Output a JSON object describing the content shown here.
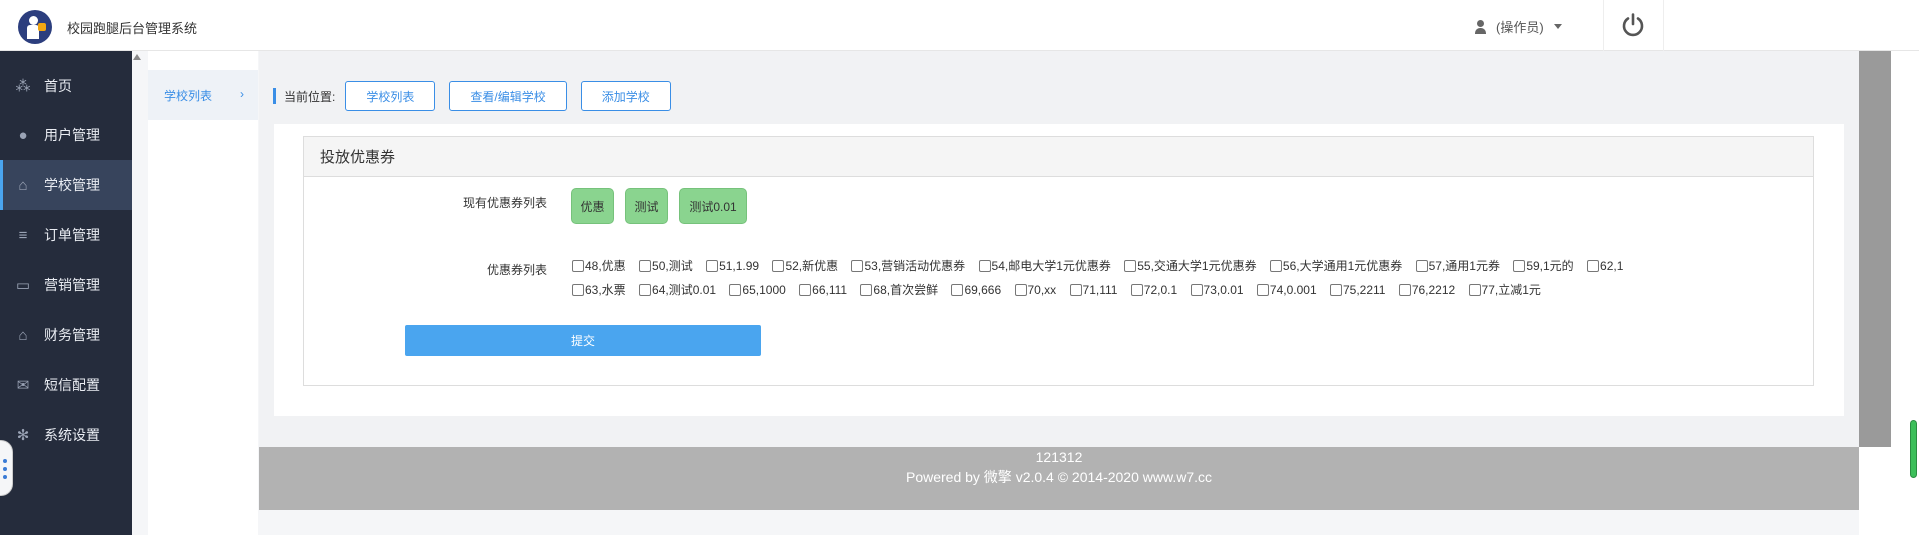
{
  "header": {
    "app_title": "校园跑腿后台管理系统",
    "user_label": "(操作员)"
  },
  "sidebar": {
    "items": [
      {
        "label": "首页",
        "icon": "cubes-icon",
        "active": false
      },
      {
        "label": "用户管理",
        "icon": "user-icon",
        "active": false
      },
      {
        "label": "学校管理",
        "icon": "bank-icon",
        "active": true
      },
      {
        "label": "订单管理",
        "icon": "list-icon",
        "active": false
      },
      {
        "label": "营销管理",
        "icon": "money-icon",
        "active": false
      },
      {
        "label": "财务管理",
        "icon": "bank-icon",
        "active": false
      },
      {
        "label": "短信配置",
        "icon": "envelope-icon",
        "active": false
      },
      {
        "label": "系统设置",
        "icon": "gear-icon",
        "active": false
      }
    ]
  },
  "subnav": {
    "item_label": "学校列表"
  },
  "breadcrumb": {
    "label": "当前位置:",
    "buttons": [
      "学校列表",
      "查看/编辑学校",
      "添加学校"
    ]
  },
  "card": {
    "title": "投放优惠券",
    "existing_label": "现有优惠券列表",
    "existing_tags": [
      "优惠",
      "测试",
      "测试0.01"
    ],
    "coupon_label": "优惠券列表",
    "coupons": [
      "48,优惠",
      "50,测试",
      "51,1.99",
      "52,新优惠",
      "53,营销活动优惠券",
      "54,邮电大学1元优惠券",
      "55,交通大学1元优惠券",
      "56,大学通用1元优惠券",
      "57,通用1元券",
      "59,1元的",
      "62,1",
      "63,水票",
      "64,测试0.01",
      "65,1000",
      "66,111",
      "68,首次尝鲜",
      "69,666",
      "70,xx",
      "71,111",
      "72,0.1",
      "73,0.01",
      "74,0.001",
      "75,2211",
      "76,2212",
      "77,立减1元"
    ],
    "submit_label": "提交"
  },
  "footer": {
    "line1": "121312",
    "line2": "Powered by 微擎 v2.0.4 © 2014-2020 www.w7.cc"
  },
  "colors": {
    "sidebar_bg": "#252c3c",
    "accent": "#4aa5ef",
    "tag_green": "#8ad48f",
    "footer_gray": "#b2b2b2"
  }
}
